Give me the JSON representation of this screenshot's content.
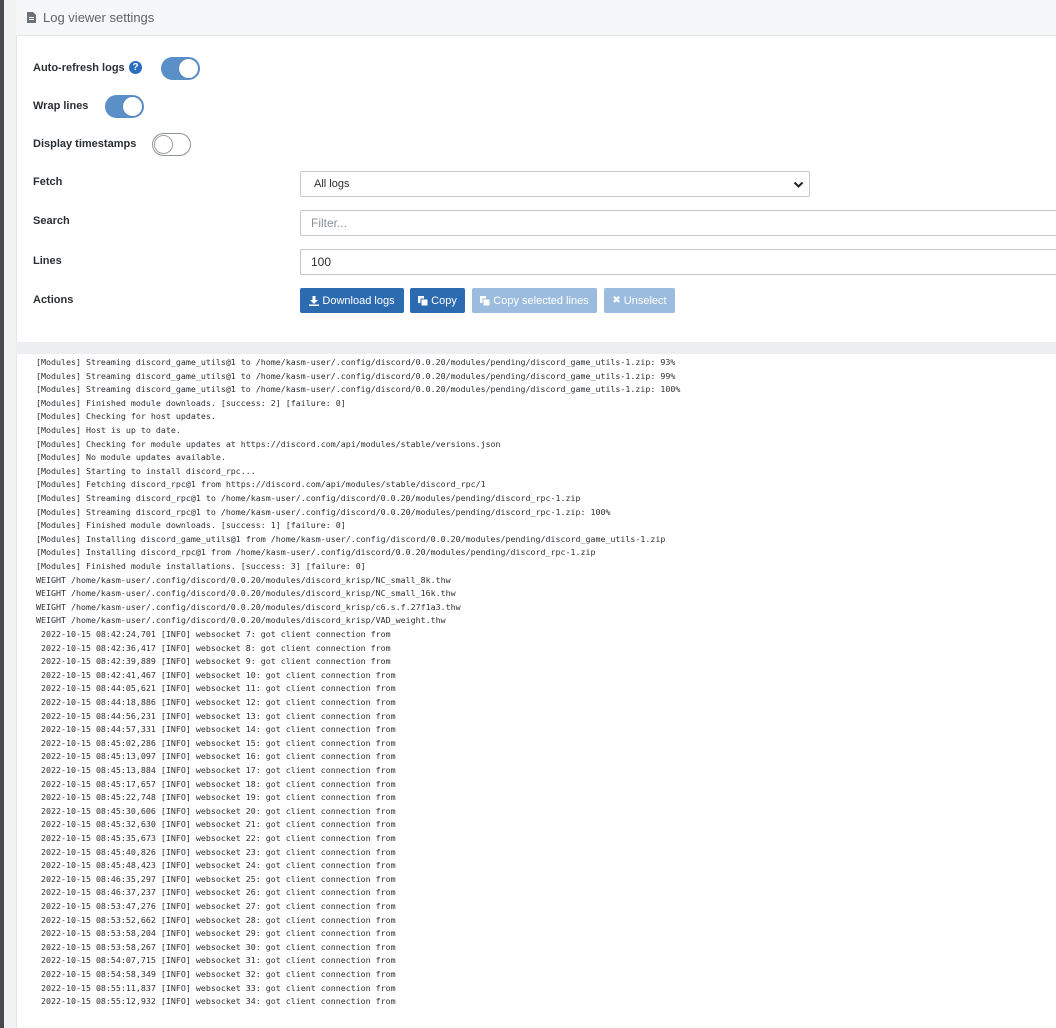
{
  "header": {
    "title": "Log viewer settings",
    "icon": "document-icon"
  },
  "settings": {
    "auto_refresh": {
      "label": "Auto-refresh logs",
      "on": true,
      "help_icon": "question-circle-icon"
    },
    "wrap_lines": {
      "label": "Wrap lines",
      "on": true
    },
    "display_timestamps": {
      "label": "Display timestamps",
      "on": false
    },
    "fetch": {
      "label": "Fetch",
      "value": "All logs"
    },
    "search": {
      "label": "Search",
      "placeholder": "Filter..."
    },
    "lines": {
      "label": "Lines",
      "value": "100"
    },
    "actions": {
      "label": "Actions",
      "download": "Download logs",
      "copy": "Copy",
      "copy_selected": "Copy selected lines",
      "unselect": "Unselect"
    }
  },
  "colors": {
    "primary": "#2c6bb0",
    "toggle_on": "#5b8fc8",
    "disabled": "#9bbcde"
  },
  "logs": [
    "[Modules] Streaming discord_game_utils@1 to /home/kasm-user/.config/discord/0.0.20/modules/pending/discord_game_utils-1.zip: 93%",
    "[Modules] Streaming discord_game_utils@1 to /home/kasm-user/.config/discord/0.0.20/modules/pending/discord_game_utils-1.zip: 99%",
    "[Modules] Streaming discord_game_utils@1 to /home/kasm-user/.config/discord/0.0.20/modules/pending/discord_game_utils-1.zip: 100%",
    "[Modules] Finished module downloads. [success: 2] [failure: 0]",
    "[Modules] Checking for host updates.",
    "[Modules] Host is up to date.",
    "[Modules] Checking for module updates at https://discord.com/api/modules/stable/versions.json",
    "[Modules] No module updates available.",
    "[Modules] Starting to install discord_rpc...",
    "[Modules] Fetching discord_rpc@1 from https://discord.com/api/modules/stable/discord_rpc/1",
    "[Modules] Streaming discord_rpc@1 to /home/kasm-user/.config/discord/0.0.20/modules/pending/discord_rpc-1.zip",
    "[Modules] Streaming discord_rpc@1 to /home/kasm-user/.config/discord/0.0.20/modules/pending/discord_rpc-1.zip: 100%",
    "[Modules] Finished module downloads. [success: 1] [failure: 0]",
    "[Modules] Installing discord_game_utils@1 from /home/kasm-user/.config/discord/0.0.20/modules/pending/discord_game_utils-1.zip",
    "[Modules] Installing discord_rpc@1 from /home/kasm-user/.config/discord/0.0.20/modules/pending/discord_rpc-1.zip",
    "[Modules] Finished module installations. [success: 3] [failure: 0]",
    "WEIGHT /home/kasm-user/.config/discord/0.0.20/modules/discord_krisp/NC_small_8k.thw",
    "WEIGHT /home/kasm-user/.config/discord/0.0.20/modules/discord_krisp/NC_small_16k.thw",
    "WEIGHT /home/kasm-user/.config/discord/0.0.20/modules/discord_krisp/c6.s.f.27f1a3.thw",
    "WEIGHT /home/kasm-user/.config/discord/0.0.20/modules/discord_krisp/VAD_weight.thw",
    " 2022-10-15 08:42:24,701 [INFO] websocket 7: got client connection from",
    " 2022-10-15 08:42:36,417 [INFO] websocket 8: got client connection from",
    " 2022-10-15 08:42:39,889 [INFO] websocket 9: got client connection from",
    " 2022-10-15 08:42:41,467 [INFO] websocket 10: got client connection from",
    " 2022-10-15 08:44:05,621 [INFO] websocket 11: got client connection from",
    " 2022-10-15 08:44:18,886 [INFO] websocket 12: got client connection from",
    " 2022-10-15 08:44:56,231 [INFO] websocket 13: got client connection from",
    " 2022-10-15 08:44:57,331 [INFO] websocket 14: got client connection from",
    " 2022-10-15 08:45:02,286 [INFO] websocket 15: got client connection from",
    " 2022-10-15 08:45:13,097 [INFO] websocket 16: got client connection from",
    " 2022-10-15 08:45:13,884 [INFO] websocket 17: got client connection from",
    " 2022-10-15 08:45:17,657 [INFO] websocket 18: got client connection from",
    " 2022-10-15 08:45:22,748 [INFO] websocket 19: got client connection from",
    " 2022-10-15 08:45:30,606 [INFO] websocket 20: got client connection from",
    " 2022-10-15 08:45:32,630 [INFO] websocket 21: got client connection from",
    " 2022-10-15 08:45:35,673 [INFO] websocket 22: got client connection from",
    " 2022-10-15 08:45:40,826 [INFO] websocket 23: got client connection from",
    " 2022-10-15 08:45:48,423 [INFO] websocket 24: got client connection from",
    " 2022-10-15 08:46:35,297 [INFO] websocket 25: got client connection from",
    " 2022-10-15 08:46:37,237 [INFO] websocket 26: got client connection from",
    " 2022-10-15 08:53:47,276 [INFO] websocket 27: got client connection from",
    " 2022-10-15 08:53:52,662 [INFO] websocket 28: got client connection from",
    " 2022-10-15 08:53:58,204 [INFO] websocket 29: got client connection from",
    " 2022-10-15 08:53:58,267 [INFO] websocket 30: got client connection from",
    " 2022-10-15 08:54:07,715 [INFO] websocket 31: got client connection from",
    " 2022-10-15 08:54:58,349 [INFO] websocket 32: got client connection from",
    " 2022-10-15 08:55:11,837 [INFO] websocket 33: got client connection from",
    " 2022-10-15 08:55:12,932 [INFO] websocket 34: got client connection from"
  ]
}
